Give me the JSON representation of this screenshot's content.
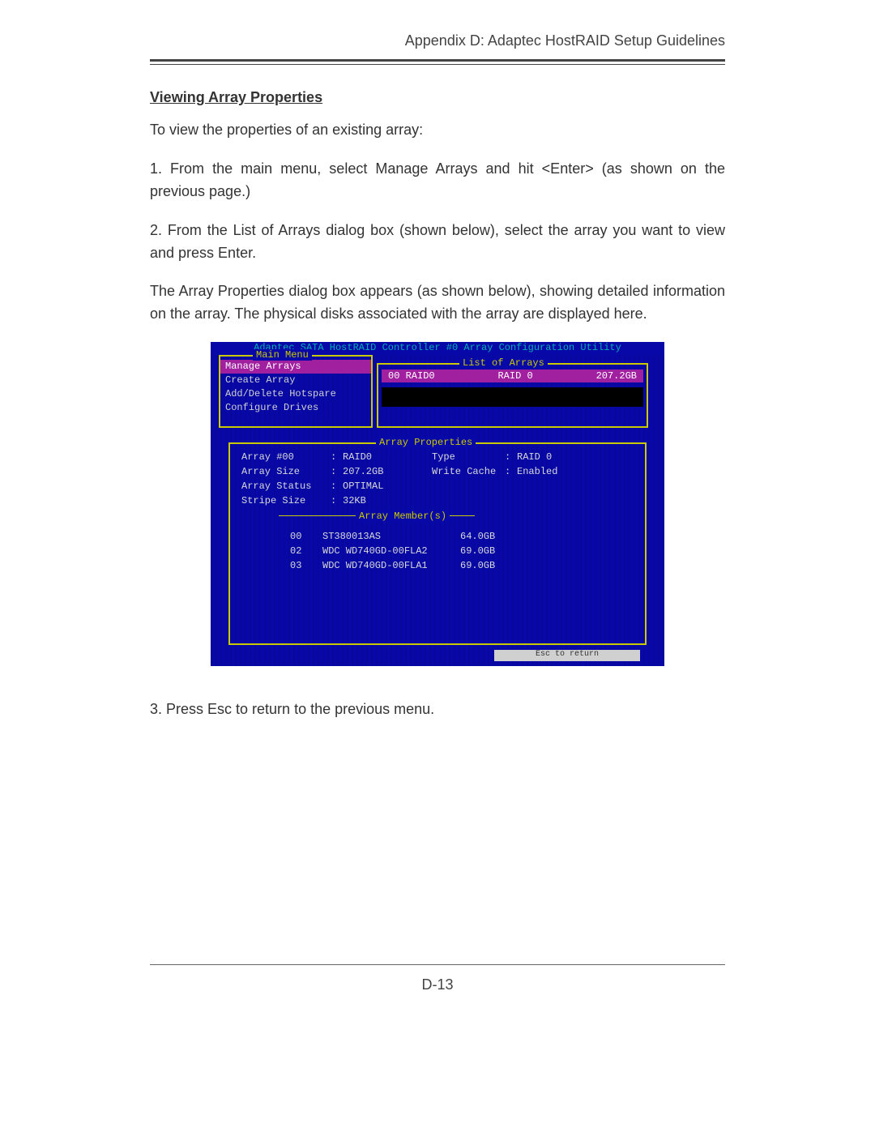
{
  "header": "Appendix D:  Adaptec HostRAID Setup Guidelines",
  "section_title": "Viewing Array Properties",
  "para_intro": "To view the properties of an existing array:",
  "step1": "1. From the main menu, select Manage Arrays and hit <Enter> (as shown on the previous page.)",
  "step2": "2. From the List of Arrays dialog box (shown below), select the array you want to view and press Enter.",
  "para_props": "The Array Properties dialog box appears (as shown below), showing detailed information on the array. The physical disks associated with the array are displayed here.",
  "step3": "3. Press Esc to return to the previous menu.",
  "page_number": "D-13",
  "screenshot": {
    "title": "Adaptec SATA HostRAID Controller #0 Array Configuration Utility",
    "main_menu": {
      "legend": "Main Menu",
      "items": [
        "Manage Arrays",
        "Create Array",
        "Add/Delete Hotspare",
        "Configure Drives"
      ],
      "selected_index": 0
    },
    "list_of_arrays": {
      "legend": "List of Arrays",
      "rows": [
        {
          "id": "00 RAID0",
          "type": "RAID 0",
          "size": "207.2GB"
        }
      ]
    },
    "array_properties": {
      "legend": "Array Properties",
      "members_legend": "Array Member(s)",
      "rows": [
        {
          "label": "Array #00",
          "value": "RAID0",
          "label2": "Type",
          "value2": "RAID 0"
        },
        {
          "label": "Array Size",
          "value": "207.2GB",
          "label2": "Write Cache",
          "value2": "Enabled"
        },
        {
          "label": "Array Status",
          "value": "OPTIMAL",
          "label2": "",
          "value2": ""
        },
        {
          "label": "Stripe Size",
          "value": "32KB",
          "label2": "",
          "value2": ""
        }
      ],
      "members": [
        {
          "slot": "00",
          "model": "ST380013AS",
          "size": "64.0GB"
        },
        {
          "slot": "02",
          "model": "WDC WD740GD-00FLA2",
          "size": "69.0GB"
        },
        {
          "slot": "03",
          "model": "WDC WD740GD-00FLA1",
          "size": "69.0GB"
        }
      ]
    },
    "status_bar": "Esc  to return"
  }
}
